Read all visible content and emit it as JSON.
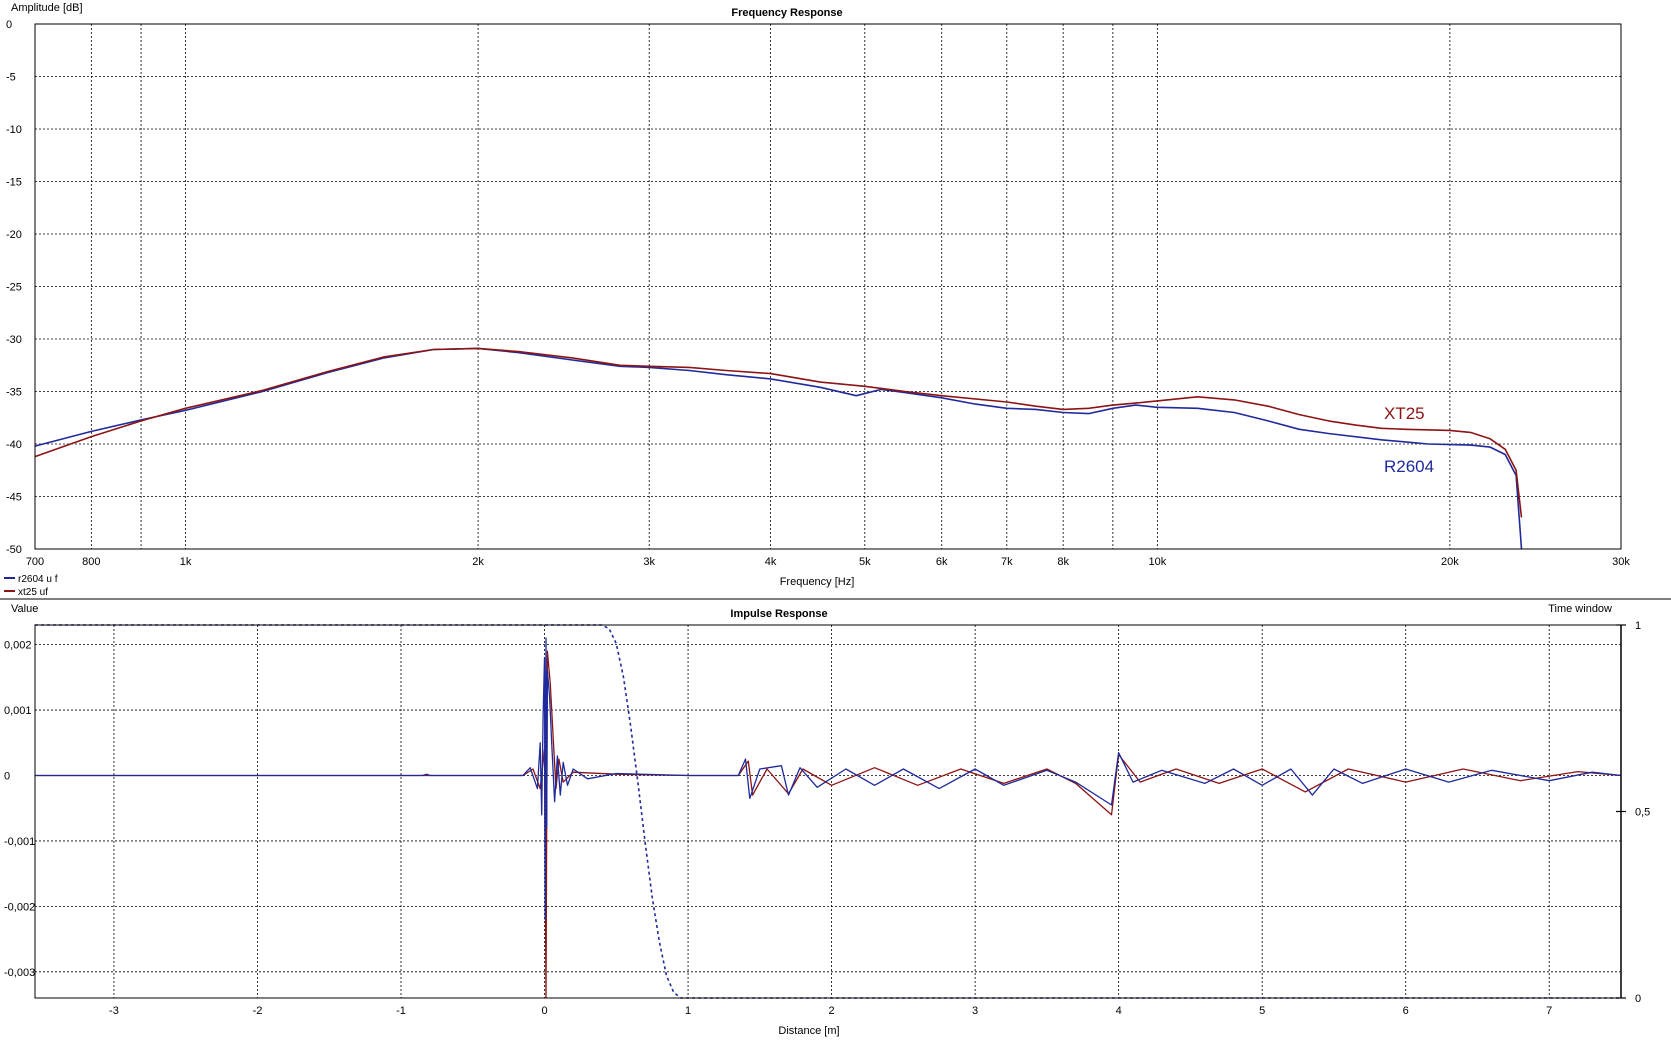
{
  "frequency_panel": {
    "title": "Frequency Response",
    "y_axis_title": "Amplitude [dB]",
    "x_axis_title": "Frequency [Hz]",
    "legend": [
      {
        "label": "r2604 u f",
        "color": "#1f2a9c"
      },
      {
        "label": "xt25 uf",
        "color": "#8c1414"
      }
    ],
    "annotations": [
      {
        "text": "XT25",
        "color": "#8c1414"
      },
      {
        "text": "R2604",
        "color": "#1f2a9c"
      }
    ]
  },
  "impulse_panel": {
    "title": "Impulse Response",
    "y_axis_title": "Value",
    "y2_axis_title": "Time window",
    "x_axis_title": "Distance [m]"
  },
  "colors": {
    "r2604": "#1f2a9c",
    "xt25": "#8c1414",
    "window": "#1f2a9c",
    "grid": "#000000"
  },
  "chart_data": [
    {
      "type": "line",
      "title": "Frequency Response",
      "xlabel": "Frequency [Hz]",
      "ylabel": "Amplitude [dB]",
      "x_scale": "log",
      "xlim": [
        700,
        30000
      ],
      "ylim": [
        -50,
        0
      ],
      "grid": true,
      "legend_position": "bottom-left",
      "x_ticks": [
        {
          "value": 700,
          "label": "700"
        },
        {
          "value": 800,
          "label": "800"
        },
        {
          "value": 900,
          "label": ""
        },
        {
          "value": 1000,
          "label": "1k"
        },
        {
          "value": 2000,
          "label": "2k"
        },
        {
          "value": 3000,
          "label": "3k"
        },
        {
          "value": 4000,
          "label": "4k"
        },
        {
          "value": 5000,
          "label": "5k"
        },
        {
          "value": 6000,
          "label": "6k"
        },
        {
          "value": 7000,
          "label": "7k"
        },
        {
          "value": 8000,
          "label": "8k"
        },
        {
          "value": 9000,
          "label": ""
        },
        {
          "value": 10000,
          "label": "10k"
        },
        {
          "value": 20000,
          "label": "20k"
        },
        {
          "value": 30000,
          "label": "30k"
        }
      ],
      "y_ticks": [
        {
          "value": 0,
          "label": "0"
        },
        {
          "value": -5,
          "label": "-5"
        },
        {
          "value": -10,
          "label": "-10"
        },
        {
          "value": -15,
          "label": "-15"
        },
        {
          "value": -20,
          "label": "-20"
        },
        {
          "value": -25,
          "label": "-25"
        },
        {
          "value": -30,
          "label": "-30"
        },
        {
          "value": -35,
          "label": "-35"
        },
        {
          "value": -40,
          "label": "-40"
        },
        {
          "value": -45,
          "label": "-45"
        },
        {
          "value": -50,
          "label": "-50"
        }
      ],
      "series": [
        {
          "name": "r2604 u f",
          "color": "#1f2a9c",
          "points": [
            [
              700,
              -40.2
            ],
            [
              800,
              -38.8
            ],
            [
              900,
              -37.7
            ],
            [
              1000,
              -36.8
            ],
            [
              1200,
              -35.0
            ],
            [
              1400,
              -33.2
            ],
            [
              1600,
              -31.8
            ],
            [
              1800,
              -31.0
            ],
            [
              2000,
              -30.9
            ],
            [
              2200,
              -31.3
            ],
            [
              2500,
              -32.0
            ],
            [
              2800,
              -32.6
            ],
            [
              3000,
              -32.7
            ],
            [
              3300,
              -33.0
            ],
            [
              3600,
              -33.4
            ],
            [
              4000,
              -33.8
            ],
            [
              4500,
              -34.6
            ],
            [
              4900,
              -35.4
            ],
            [
              5200,
              -34.8
            ],
            [
              5500,
              -35.1
            ],
            [
              6000,
              -35.6
            ],
            [
              6500,
              -36.2
            ],
            [
              7000,
              -36.6
            ],
            [
              7500,
              -36.7
            ],
            [
              8000,
              -37.0
            ],
            [
              8500,
              -37.1
            ],
            [
              9000,
              -36.6
            ],
            [
              9500,
              -36.3
            ],
            [
              10000,
              -36.5
            ],
            [
              11000,
              -36.6
            ],
            [
              12000,
              -37.0
            ],
            [
              13000,
              -37.8
            ],
            [
              14000,
              -38.6
            ],
            [
              15000,
              -39.0
            ],
            [
              17000,
              -39.6
            ],
            [
              19000,
              -40.0
            ],
            [
              21000,
              -40.1
            ],
            [
              22000,
              -40.3
            ],
            [
              22800,
              -41.0
            ],
            [
              23400,
              -43.0
            ],
            [
              23700,
              -50.0
            ]
          ]
        },
        {
          "name": "xt25 uf",
          "color": "#8c1414",
          "points": [
            [
              700,
              -41.2
            ],
            [
              800,
              -39.3
            ],
            [
              900,
              -37.8
            ],
            [
              1000,
              -36.6
            ],
            [
              1200,
              -34.9
            ],
            [
              1400,
              -33.1
            ],
            [
              1600,
              -31.7
            ],
            [
              1800,
              -31.0
            ],
            [
              2000,
              -30.9
            ],
            [
              2200,
              -31.2
            ],
            [
              2500,
              -31.8
            ],
            [
              2800,
              -32.5
            ],
            [
              3000,
              -32.6
            ],
            [
              3300,
              -32.7
            ],
            [
              3600,
              -33.0
            ],
            [
              4000,
              -33.3
            ],
            [
              4500,
              -34.1
            ],
            [
              5000,
              -34.5
            ],
            [
              5500,
              -35.0
            ],
            [
              6000,
              -35.4
            ],
            [
              7000,
              -36.0
            ],
            [
              7500,
              -36.4
            ],
            [
              8000,
              -36.7
            ],
            [
              8500,
              -36.6
            ],
            [
              9000,
              -36.3
            ],
            [
              9500,
              -36.1
            ],
            [
              10000,
              -35.9
            ],
            [
              11000,
              -35.5
            ],
            [
              12000,
              -35.8
            ],
            [
              13000,
              -36.4
            ],
            [
              14000,
              -37.2
            ],
            [
              15000,
              -37.8
            ],
            [
              16000,
              -38.2
            ],
            [
              17000,
              -38.5
            ],
            [
              18000,
              -38.6
            ],
            [
              20000,
              -38.7
            ],
            [
              21000,
              -38.9
            ],
            [
              22000,
              -39.5
            ],
            [
              22800,
              -40.5
            ],
            [
              23400,
              -42.5
            ],
            [
              23700,
              -47.0
            ]
          ]
        }
      ]
    },
    {
      "type": "line",
      "title": "Impulse Response",
      "xlabel": "Distance [m]",
      "ylabel": "Value",
      "y2label": "Time window",
      "xlim": [
        -3.55,
        7.5
      ],
      "ylim": [
        -0.0034,
        0.0023
      ],
      "y2lim": [
        0,
        1
      ],
      "grid": true,
      "x_ticks": [
        {
          "value": -3,
          "label": "-3"
        },
        {
          "value": -2,
          "label": "-2"
        },
        {
          "value": -1,
          "label": "-1"
        },
        {
          "value": 0,
          "label": "0"
        },
        {
          "value": 1,
          "label": "1"
        },
        {
          "value": 2,
          "label": "2"
        },
        {
          "value": 3,
          "label": "3"
        },
        {
          "value": 4,
          "label": "4"
        },
        {
          "value": 5,
          "label": "5"
        },
        {
          "value": 6,
          "label": "6"
        },
        {
          "value": 7,
          "label": "7"
        }
      ],
      "y_ticks": [
        {
          "value": 0.002,
          "label": "0,002"
        },
        {
          "value": 0.001,
          "label": "0,001"
        },
        {
          "value": 0,
          "label": "0"
        },
        {
          "value": -0.001,
          "label": "-0,001"
        },
        {
          "value": -0.002,
          "label": "-0,002"
        },
        {
          "value": -0.003,
          "label": "-0,003"
        }
      ],
      "y2_ticks": [
        {
          "value": 1,
          "label": "1"
        },
        {
          "value": 0.5,
          "label": "0,5"
        },
        {
          "value": 0,
          "label": "0"
        }
      ],
      "series": [
        {
          "name": "r2604 u f",
          "color": "#1f2a9c",
          "points": [
            [
              -3.55,
              0
            ],
            [
              -0.85,
              0
            ],
            [
              -0.82,
              2e-05
            ],
            [
              -0.8,
              0
            ],
            [
              -0.15,
              0
            ],
            [
              -0.1,
              0.00012
            ],
            [
              -0.05,
              -0.0002
            ],
            [
              -0.03,
              0.0005
            ],
            [
              -0.02,
              -0.0006
            ],
            [
              -0.01,
              0.0009
            ],
            [
              0,
              0.0018
            ],
            [
              0.005,
              -0.0022
            ],
            [
              0.01,
              0.0021
            ],
            [
              0.015,
              -0.0008
            ],
            [
              0.02,
              0.0016
            ],
            [
              0.035,
              0.0012
            ],
            [
              0.05,
              0.0005
            ],
            [
              0.07,
              -0.0004
            ],
            [
              0.09,
              0.0003
            ],
            [
              0.11,
              -0.0003
            ],
            [
              0.13,
              0.0002
            ],
            [
              0.16,
              -0.00015
            ],
            [
              0.2,
              0.0001
            ],
            [
              0.3,
              -5e-05
            ],
            [
              0.5,
              3e-05
            ],
            [
              1.0,
              0
            ],
            [
              1.35,
              0
            ],
            [
              1.4,
              0.00025
            ],
            [
              1.43,
              -0.00035
            ],
            [
              1.5,
              0.0001
            ],
            [
              1.65,
              0.00015
            ],
            [
              1.7,
              -0.0003
            ],
            [
              1.78,
              0.00012
            ],
            [
              1.9,
              -0.00018
            ],
            [
              2.1,
              0.0001
            ],
            [
              2.3,
              -0.00015
            ],
            [
              2.5,
              0.0001
            ],
            [
              2.75,
              -0.0002
            ],
            [
              3.0,
              0.0001
            ],
            [
              3.2,
              -0.00015
            ],
            [
              3.5,
              8e-05
            ],
            [
              3.7,
              -0.0001
            ],
            [
              3.95,
              -0.00045
            ],
            [
              4.0,
              0.00035
            ],
            [
              4.1,
              -0.0001
            ],
            [
              4.3,
              8e-05
            ],
            [
              4.6,
              -0.00012
            ],
            [
              4.8,
              0.0001
            ],
            [
              5.0,
              -0.00015
            ],
            [
              5.2,
              0.0001
            ],
            [
              5.35,
              -0.0003
            ],
            [
              5.5,
              0.0001
            ],
            [
              5.7,
              -0.00012
            ],
            [
              6.0,
              0.0001
            ],
            [
              6.3,
              -0.0001
            ],
            [
              6.6,
              8e-05
            ],
            [
              7.0,
              -8e-05
            ],
            [
              7.3,
              5e-05
            ],
            [
              7.5,
              0
            ]
          ]
        },
        {
          "name": "xt25 uf",
          "color": "#8c1414",
          "points": [
            [
              -3.55,
              0
            ],
            [
              -0.15,
              0
            ],
            [
              -0.08,
              0.0001
            ],
            [
              -0.03,
              -0.0002
            ],
            [
              0,
              0.0004
            ],
            [
              0.01,
              -0.0034
            ],
            [
              0.02,
              0.0019
            ],
            [
              0.04,
              0.0014
            ],
            [
              0.06,
              0.0006
            ],
            [
              0.08,
              -0.0002
            ],
            [
              0.1,
              0.00025
            ],
            [
              0.13,
              -0.0001
            ],
            [
              0.2,
              5e-05
            ],
            [
              0.5,
              2e-05
            ],
            [
              1.0,
              0
            ],
            [
              1.35,
              0
            ],
            [
              1.42,
              0.00022
            ],
            [
              1.45,
              -0.0003
            ],
            [
              1.55,
              0.0001
            ],
            [
              1.7,
              -0.00028
            ],
            [
              1.8,
              0.0001
            ],
            [
              2.0,
              -0.00015
            ],
            [
              2.3,
              0.00012
            ],
            [
              2.6,
              -0.00015
            ],
            [
              2.9,
              0.0001
            ],
            [
              3.2,
              -0.00012
            ],
            [
              3.5,
              0.0001
            ],
            [
              3.7,
              -0.00012
            ],
            [
              3.95,
              -0.0006
            ],
            [
              4.0,
              0.00032
            ],
            [
              4.15,
              -0.0001
            ],
            [
              4.4,
              0.0001
            ],
            [
              4.7,
              -0.00012
            ],
            [
              5.0,
              0.0001
            ],
            [
              5.3,
              -0.00025
            ],
            [
              5.6,
              0.0001
            ],
            [
              6.0,
              -0.0001
            ],
            [
              6.4,
              0.0001
            ],
            [
              6.8,
              -8e-05
            ],
            [
              7.2,
              6e-05
            ],
            [
              7.5,
              0
            ]
          ]
        },
        {
          "name": "Time window",
          "color": "#1f2a9c",
          "axis": "y2",
          "dashed": true,
          "points": [
            [
              -3.55,
              1
            ],
            [
              0.4,
              1
            ],
            [
              0.45,
              0.99
            ],
            [
              0.5,
              0.95
            ],
            [
              0.55,
              0.86
            ],
            [
              0.6,
              0.73
            ],
            [
              0.65,
              0.58
            ],
            [
              0.7,
              0.42
            ],
            [
              0.75,
              0.27
            ],
            [
              0.8,
              0.15
            ],
            [
              0.85,
              0.06
            ],
            [
              0.9,
              0.015
            ],
            [
              0.95,
              0
            ],
            [
              7.5,
              0
            ]
          ]
        }
      ]
    }
  ]
}
